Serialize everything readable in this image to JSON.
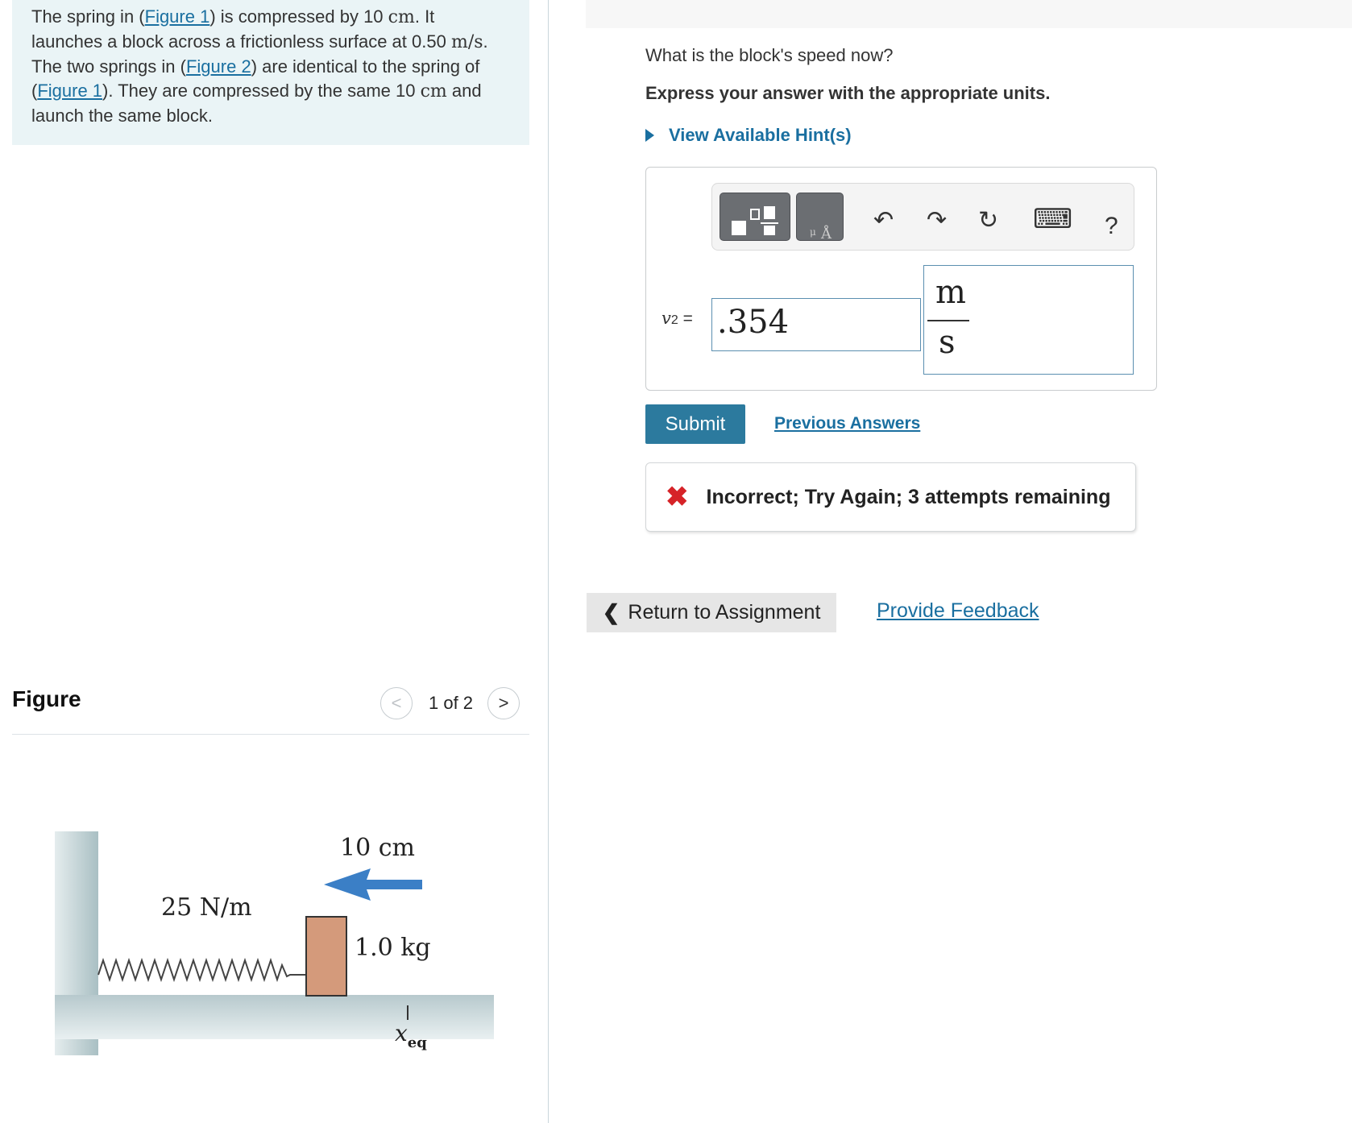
{
  "problem": {
    "t1": "The spring in (",
    "link_fig1": "Figure 1",
    "t2": ") is compressed by 10 ",
    "unit_cm": "cm",
    "t3": ". It launches a block across a frictionless surface at ",
    "speed_value": "0.50",
    "speed_unit": "m/s",
    "t4": ". The two springs in (",
    "link_fig2": "Figure 2",
    "t5": ") are identical to the spring of (",
    "link_fig1b": "Figure 1",
    "t6": "). They are compressed by the same 10 ",
    "unit_cm2": "cm",
    "t7": " and launch the same block."
  },
  "figure": {
    "title": "Figure",
    "counter": "1 of 2",
    "prev_icon": "<",
    "next_icon": ">",
    "labels": {
      "compression": "10 cm",
      "spring_constant": "25 N/m",
      "mass": "1.0 kg",
      "equilibrium": "x",
      "equilibrium_sub": "eq"
    },
    "colors": {
      "arrow": "#3b7fc6",
      "block": "#d49a7b",
      "wall": "#b7c9cd"
    }
  },
  "question": {
    "text": "What is the block's speed now?",
    "instruction": "Express your answer with the appropriate units.",
    "hint_link": "View Available Hint(s)"
  },
  "toolbar": {
    "undo_icon": "↶",
    "redo_icon": "↷",
    "reset_icon": "↻",
    "keyboard_icon": "⌨",
    "help_label": "?"
  },
  "answer": {
    "variable": "v",
    "subscript": "2",
    "equals": "=",
    "value": ".354",
    "unit_numerator": "m",
    "unit_denominator": "s"
  },
  "actions": {
    "submit": "Submit",
    "previous_answers": "Previous Answers"
  },
  "feedback": {
    "icon": "✖",
    "message": "Incorrect; Try Again; 3 attempts remaining",
    "color": "#d62328"
  },
  "footer": {
    "return_chevron": "❮",
    "return_label": "Return to Assignment",
    "provide_feedback": "Provide Feedback"
  }
}
